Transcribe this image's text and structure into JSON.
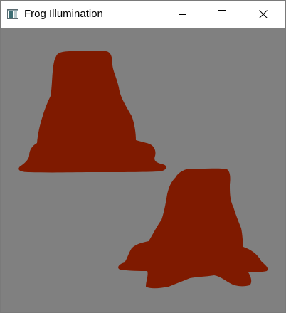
{
  "window": {
    "title": "Frog Illumination"
  },
  "titlebar": {
    "icons": {
      "app": "app-window-icon",
      "minimize": "minimize-icon",
      "maximize": "maximize-icon",
      "close": "close-icon"
    }
  },
  "canvas": {
    "background_color": "#808080",
    "objects": [
      {
        "name": "frog-silhouette-1",
        "color": "#7f1a00"
      },
      {
        "name": "frog-silhouette-2",
        "color": "#7f1a00"
      }
    ]
  }
}
